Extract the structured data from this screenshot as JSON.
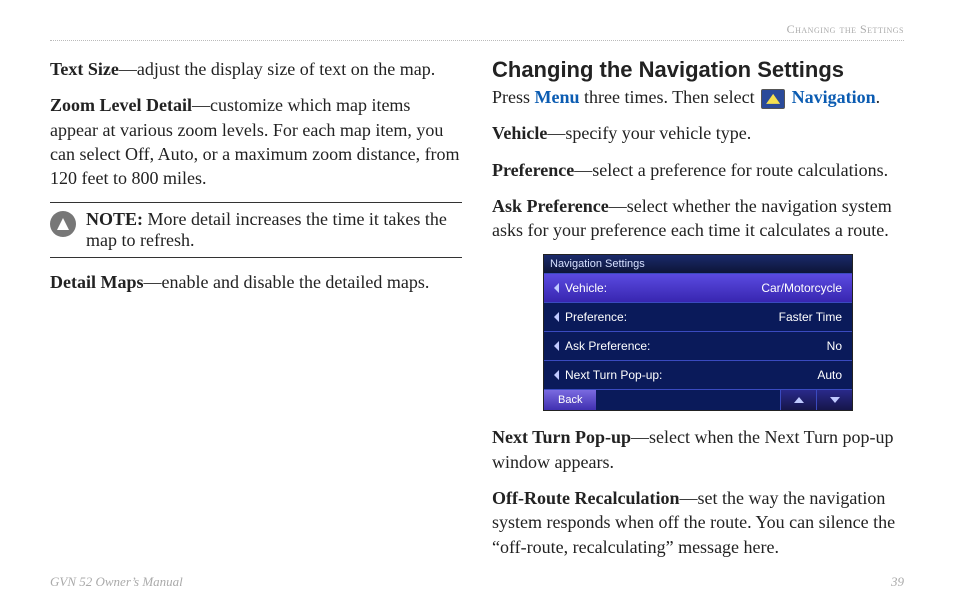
{
  "header": {
    "section_label": "Changing the Settings"
  },
  "left": {
    "text_size_label": "Text Size",
    "text_size_body": "—adjust the display size of text on the map.",
    "zoom_label": "Zoom Level Detail",
    "zoom_body": "—customize which map items appear at various zoom levels. For each map item, you can select Off, Auto, or a maximum zoom distance, from 120 feet to 800 miles.",
    "note_label": "NOTE:",
    "note_body": " More detail increases the time it takes the map to refresh.",
    "detail_maps_label": "Detail Maps",
    "detail_maps_body": "—enable and disable the detailed maps."
  },
  "right": {
    "heading": "Changing the Navigation Settings",
    "intro_pre": "Press ",
    "intro_menu": "Menu",
    "intro_mid": " three times. Then select ",
    "intro_nav": " Navigation",
    "intro_end": ".",
    "vehicle_label": "Vehicle",
    "vehicle_body": "—specify your vehicle type.",
    "preference_label": "Preference",
    "preference_body": "—select a preference for route calculations.",
    "ask_label": "Ask Preference",
    "ask_body": "—select whether the navigation system asks for your preference each time it calculates a route.",
    "next_turn_label": "Next Turn Pop-up",
    "next_turn_body": "—select when the Next Turn pop-up window appears.",
    "offroute_label": "Off-Route Recalculation",
    "offroute_body": "—set the way the navigation system responds when off the route. You can silence the “off-route, recalculating” message here."
  },
  "device": {
    "title": "Navigation Settings",
    "rows": [
      {
        "label": "Vehicle:",
        "value": "Car/Motorcycle"
      },
      {
        "label": "Preference:",
        "value": "Faster Time"
      },
      {
        "label": "Ask Preference:",
        "value": "No"
      },
      {
        "label": "Next Turn Pop-up:",
        "value": "Auto"
      }
    ],
    "back": "Back"
  },
  "footer": {
    "left": "GVN 52 Owner’s Manual",
    "right": "39"
  }
}
